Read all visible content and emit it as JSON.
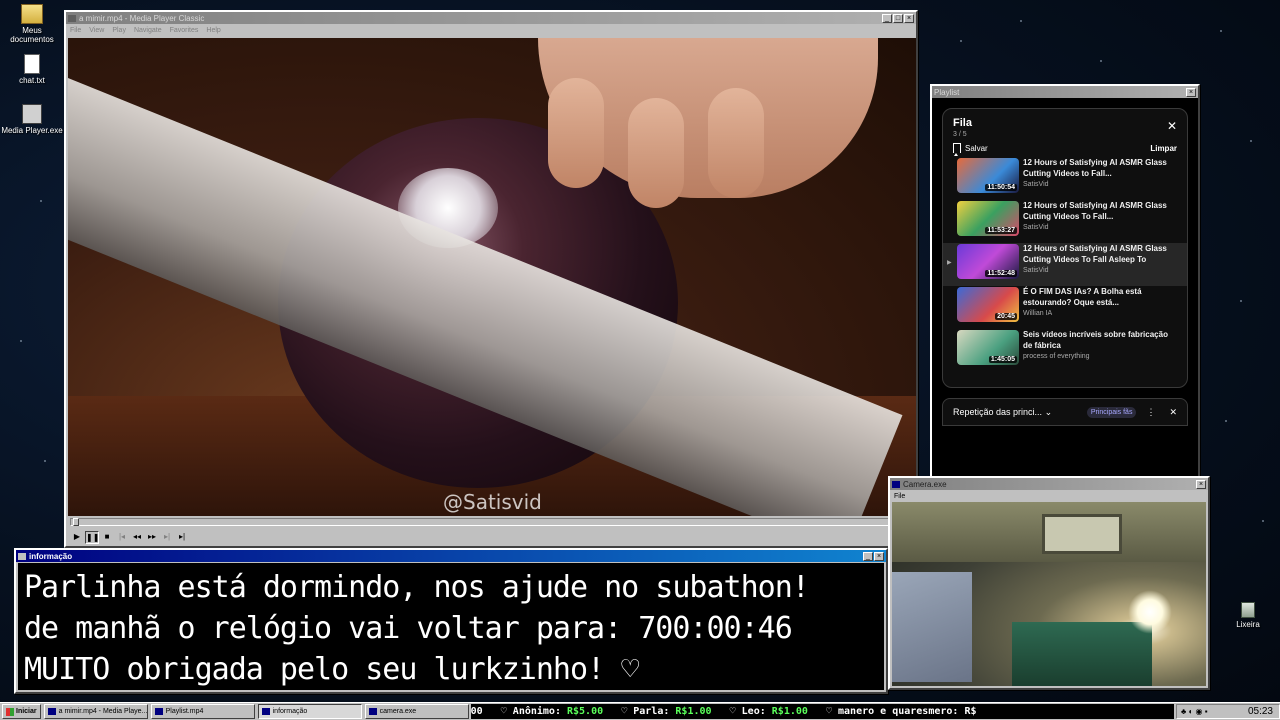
{
  "desktop": {
    "icons": [
      {
        "label": "Meus documentos"
      },
      {
        "label": "chat.txt"
      },
      {
        "label": "Media Player.exe"
      },
      {
        "label": "Lixeira"
      }
    ]
  },
  "player": {
    "title": "a mimir.mp4 - Media Player Classic",
    "menu": [
      "File",
      "View",
      "Play",
      "Navigate",
      "Favorites",
      "Help"
    ],
    "watermark": "@Satisvid",
    "controls": [
      "play",
      "pause",
      "stop",
      "prev",
      "rewind",
      "forward",
      "next",
      "frame-step"
    ]
  },
  "playlist": {
    "title": "Playlist",
    "queue_title": "Fila",
    "position": "3 / 5",
    "save_label": "Salvar",
    "clear_label": "Limpar",
    "items": [
      {
        "title": "12 Hours of Satisfying AI ASMR Glass Cutting Videos to Fall...",
        "channel": "SatisVid",
        "duration": "11:50:54"
      },
      {
        "title": "12 Hours of Satisfying AI ASMR Glass Cutting Videos To Fall...",
        "channel": "SatisVid",
        "duration": "11:53:27"
      },
      {
        "title": "12 Hours of Satisfying AI ASMR Glass Cutting Videos To Fall Asleep To",
        "channel": "SatisVid",
        "duration": "11:52:48"
      },
      {
        "title": "É O FIM DAS IAs? A Bolha está estourando? Oque está...",
        "channel": "Willian IA",
        "duration": "20:45"
      },
      {
        "title": "Seis vídeos incríveis sobre fabricação de fábrica",
        "channel": "process of everything",
        "duration": "1:45:05"
      }
    ],
    "repeat_label": "Repetição das princi...",
    "badge_label": "Principais fãs"
  },
  "info": {
    "title": "informação",
    "lines": [
      "Parlinha está dormindo, nos ajude no subathon!",
      "de manhã o relógio vai voltar para:  700:00:46",
      "MUITO obrigada pelo seu lurkzinho! ♡"
    ]
  },
  "camera": {
    "title": "Camera.exe",
    "menu": [
      "File"
    ]
  },
  "taskbar": {
    "start_label": "Iniciar",
    "items": [
      {
        "label": "a mimir.mp4 - Media Playe..."
      },
      {
        "label": "Playlist.mp4"
      },
      {
        "label": "informação"
      },
      {
        "label": "camera.exe"
      }
    ],
    "ticker_prefix": "00",
    "donations": [
      {
        "name": "Anônimo:",
        "amount": "R$5.00"
      },
      {
        "name": "Parla:",
        "amount": "R$1.00"
      },
      {
        "name": "Leo:",
        "amount": "R$1.00"
      }
    ],
    "ticker_tail": "♡ manero e quaresmero: R$",
    "clock": "05:23"
  },
  "colors": {
    "title_active": "#000080",
    "ticker_amount": "#5aff5a"
  }
}
